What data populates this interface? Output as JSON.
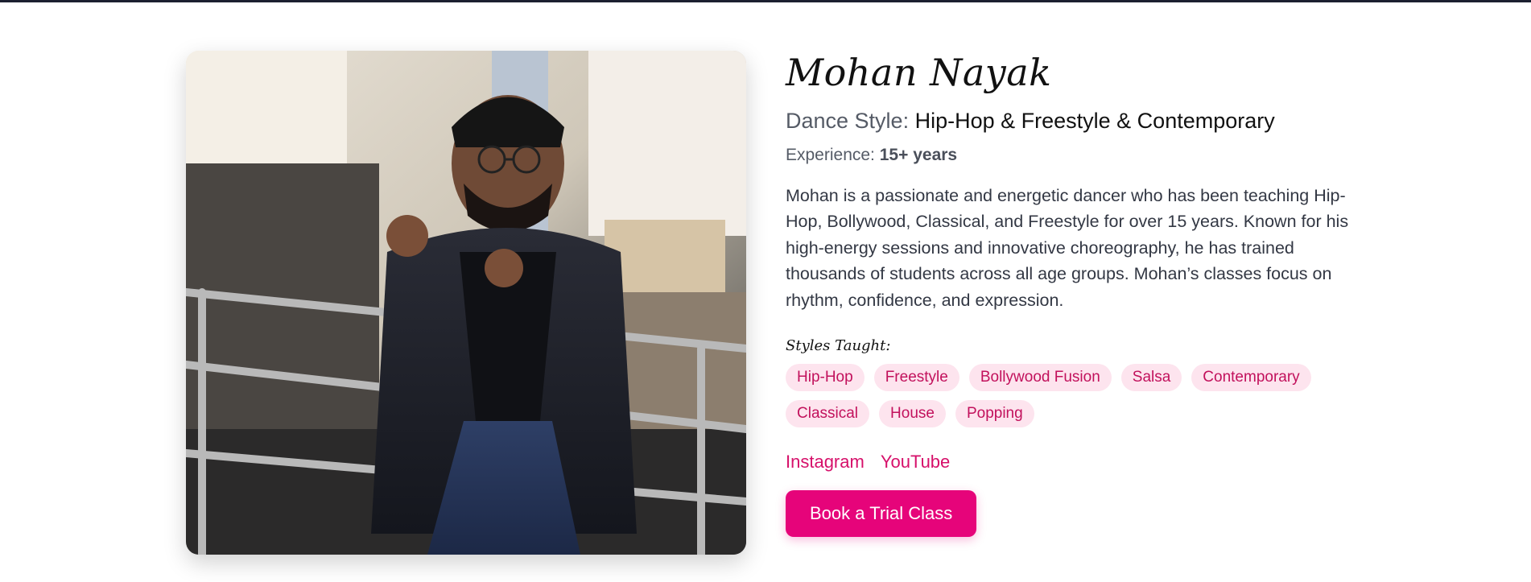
{
  "profile": {
    "name": "Mohan Nayak",
    "dance_style_label": "Dance Style:",
    "dance_style_value": "Hip-Hop & Freestyle & Contemporary",
    "experience_label": "Experience:",
    "experience_value": "15+ years",
    "bio": "Mohan is a passionate and energetic dancer who has been teaching Hip-Hop, Bollywood, Classical, and Freestyle for over 15 years. Known for his high-energy sessions and innovative choreography, he has trained thousands of students across all age groups. Mohan’s classes focus on rhythm, confidence, and expression.",
    "styles_title": "Styles Taught:",
    "styles": [
      "Hip-Hop",
      "Freestyle",
      "Bollywood Fusion",
      "Salsa",
      "Contemporary",
      "Classical",
      "House",
      "Popping"
    ],
    "links": {
      "instagram": "Instagram",
      "youtube": "YouTube"
    },
    "cta_label": "Book a Trial Class"
  },
  "colors": {
    "accent": "#e6047a",
    "tag_bg": "#fde4ee",
    "tag_text": "#c2115c",
    "link": "#d6106a"
  }
}
